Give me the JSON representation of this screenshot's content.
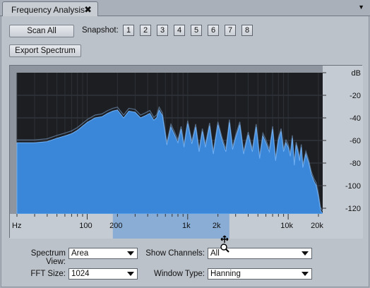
{
  "tab": {
    "title": "Frequency Analysis",
    "close_glyph": "✖",
    "menu_glyph": "▼"
  },
  "toolbar": {
    "scan_all_label": "Scan All",
    "snapshot_label": "Snapshot:",
    "snapshots": [
      "1",
      "2",
      "3",
      "4",
      "5",
      "6",
      "7",
      "8"
    ],
    "export_label": "Export Spectrum"
  },
  "graph": {
    "db_labels": [
      "dB",
      "-20",
      "-40",
      "-60",
      "-80",
      "-100",
      "-120"
    ],
    "freq_unit_label": "Hz",
    "freq_labels": [
      "100",
      "200",
      "1k",
      "2k",
      "10k",
      "20k"
    ],
    "colors": {
      "background": "#1c1e22",
      "fill": "#3a86d8",
      "line": "#6fb0f5",
      "ghost": "#7ea4cf",
      "selection": "#7fa8d6"
    }
  },
  "chart_data": {
    "type": "area",
    "xlabel": "Hz",
    "ylabel": "dB",
    "x_scale": "log",
    "xlim": [
      20,
      22050
    ],
    "ylim": [
      -125,
      0
    ],
    "x_ticks": [
      "100",
      "200",
      "1k",
      "2k",
      "10k",
      "20k"
    ],
    "y_ticks": [
      "-20",
      "-40",
      "-60",
      "-80",
      "-100",
      "-120"
    ],
    "series": [
      {
        "x": [
          20,
          30,
          40,
          50,
          60,
          70,
          80,
          100,
          120,
          140,
          160,
          180,
          200,
          230,
          260,
          300,
          340,
          380,
          420,
          460,
          490,
          520,
          560,
          620,
          680,
          740,
          800,
          860,
          920,
          1000,
          1100,
          1200,
          1300,
          1400,
          1500,
          1650,
          1800,
          2000,
          2200,
          2400,
          2600,
          2800,
          3000,
          3300,
          3600,
          4000,
          4400,
          4800,
          5200,
          5600,
          6000,
          6500,
          7000,
          7500,
          8000,
          8500,
          9000,
          9500,
          10000,
          10500,
          11000,
          11500,
          12000,
          12500,
          13000,
          13500,
          14000,
          15000,
          16000,
          17000,
          18000,
          19000,
          20000,
          21000,
          22050
        ],
        "values": [
          -62,
          -62,
          -61,
          -58,
          -56,
          -54,
          -51,
          -44,
          -40,
          -39,
          -36,
          -34,
          -33,
          -40,
          -34,
          -35,
          -40,
          -38,
          -36,
          -42,
          -40,
          -33,
          -38,
          -64,
          -48,
          -55,
          -62,
          -50,
          -66,
          -45,
          -63,
          -48,
          -70,
          -52,
          -66,
          -47,
          -72,
          -46,
          -60,
          -70,
          -44,
          -68,
          -58,
          -46,
          -72,
          -55,
          -70,
          -48,
          -76,
          -56,
          -62,
          -70,
          -50,
          -78,
          -60,
          -52,
          -70,
          -62,
          -66,
          -74,
          -58,
          -82,
          -64,
          -70,
          -78,
          -66,
          -84,
          -72,
          -80,
          -90,
          -96,
          -100,
          -110,
          -122,
          -125
        ]
      }
    ]
  },
  "controls": {
    "spectrum_view_label": "Spectrum View:",
    "spectrum_view_value": "Area",
    "show_channels_label": "Show Channels:",
    "show_channels_value": "All",
    "fft_size_label": "FFT Size:",
    "fft_size_value": "1024",
    "window_type_label": "Window Type:",
    "window_type_value": "Hanning"
  }
}
